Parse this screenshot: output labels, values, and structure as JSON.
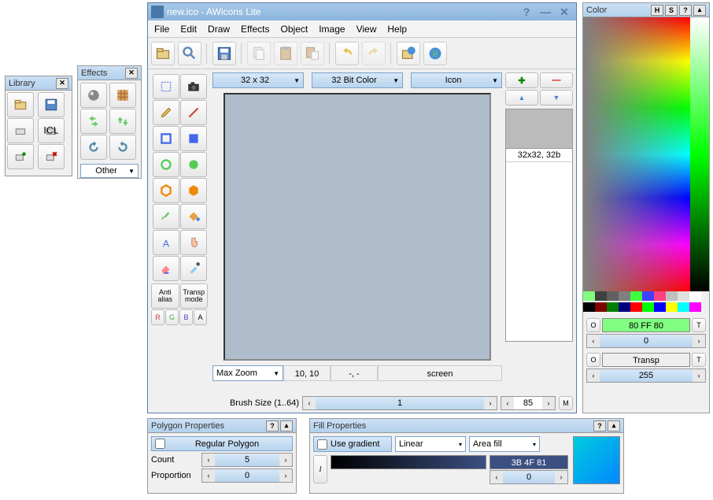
{
  "library": {
    "title": "Library"
  },
  "effects": {
    "title": "Effects",
    "other": "Other"
  },
  "main": {
    "title": "new.ico - AWicons Lite",
    "menu": [
      "File",
      "Edit",
      "Draw",
      "Effects",
      "Object",
      "Image",
      "View",
      "Help"
    ],
    "size_combo": "32 x 32",
    "color_combo": "32 Bit Color",
    "type_combo": "Icon",
    "preview_label": "32x32, 32b",
    "zoom": "Max Zoom",
    "cursor": "10, 10",
    "dash": "-, -",
    "screen": "screen",
    "brush_label": "Brush Size (1..64)",
    "brush_val": "1",
    "scroll_val": "85",
    "m": "M",
    "anti_alias": "Anti alias",
    "transp_mode": "Transp mode",
    "r": "R",
    "g": "G",
    "b": "B",
    "a": "A"
  },
  "color": {
    "title": "Color",
    "o1": "O",
    "t1": "T",
    "hex1": "80 FF 80",
    "val1": "0",
    "o2": "O",
    "t2": "T",
    "transp": "Transp",
    "val2": "255"
  },
  "poly": {
    "title": "Polygon Properties",
    "regular": "Regular Polygon",
    "count_lbl": "Count",
    "count_val": "5",
    "prop_lbl": "Proportion",
    "prop_val": "0"
  },
  "fill": {
    "title": "Fill Properties",
    "use_grad": "Use gradient",
    "grad_type": "Linear",
    "area": "Area fill",
    "hex": "3B 4F 81",
    "val": "0",
    "i": "I"
  },
  "swatches_top": [
    "#80ff80",
    "#404040",
    "#606060",
    "#808080",
    "#40ff40",
    "#4040ff",
    "#ff4080",
    "#c0c0c0",
    "#e0e0e0",
    "#ffffff"
  ],
  "swatches_bot": [
    "#000000",
    "#800000",
    "#008000",
    "#000080",
    "#ff0000",
    "#00ff00",
    "#0000ff",
    "#ffff00",
    "#00ffff",
    "#ff00ff"
  ]
}
